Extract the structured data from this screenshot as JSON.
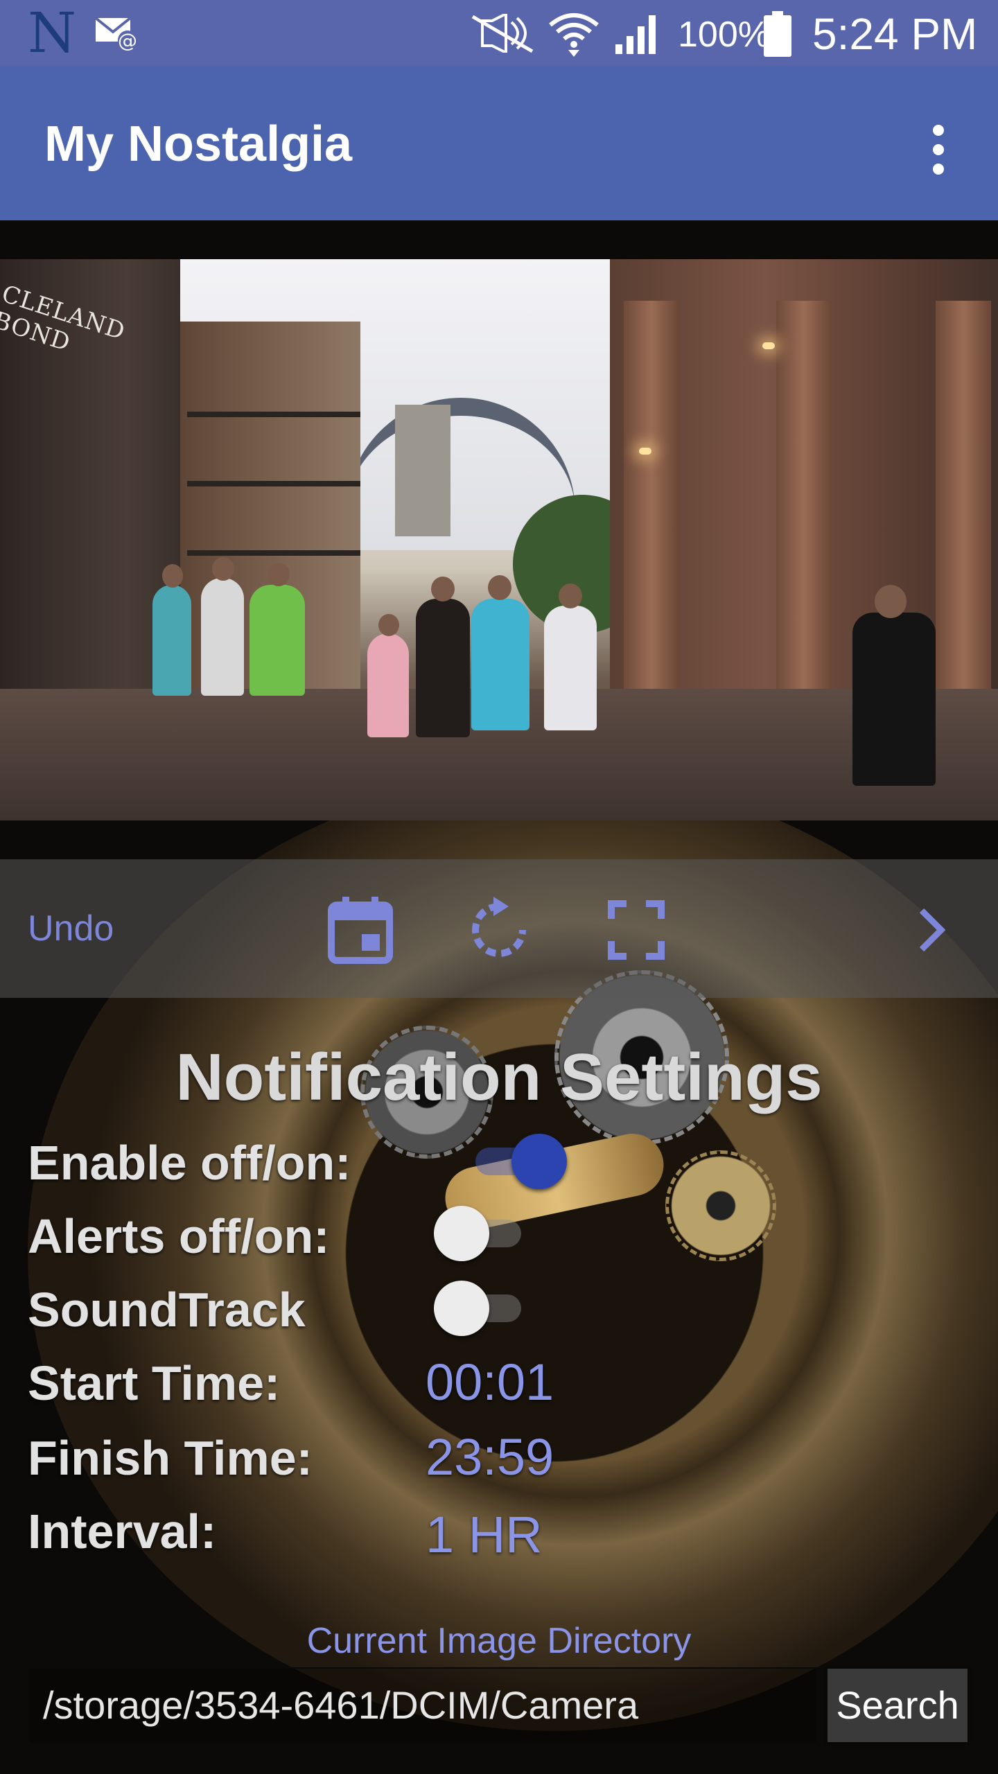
{
  "status_bar": {
    "notification_app_letter": "N",
    "battery_percent": "100%",
    "time": "5:24 PM",
    "icons": [
      "n-app-icon",
      "mail-at-icon",
      "mute-icon",
      "wifi-icon",
      "signal-icon",
      "battery-icon"
    ]
  },
  "app_bar": {
    "title": "My Nostalgia",
    "menu_icon": "more-vert-icon",
    "color": "#4c64ad"
  },
  "photo": {
    "sign_text": "CLELAND BOND"
  },
  "toolbar": {
    "undo_label": "Undo",
    "icons": [
      "calendar-icon",
      "rotate-icon",
      "fullscreen-icon",
      "chevron-right-icon"
    ],
    "accent_color": "#7d86d8"
  },
  "settings": {
    "title": "Notification Settings",
    "enable_label": "Enable off/on:",
    "enable_on": true,
    "alerts_label": "Alerts off/on:",
    "alerts_on": false,
    "soundtrack_label": "SoundTrack",
    "soundtrack_on": false,
    "start_label": "Start Time:",
    "start_value": "00:01",
    "finish_label": "Finish Time:",
    "finish_value": "23:59",
    "interval_label": "Interval:",
    "interval_value": "1 HR"
  },
  "directory": {
    "label": "Current Image Directory",
    "path": "/storage/3534-6461/DCIM/Camera",
    "search_label": "Search"
  }
}
